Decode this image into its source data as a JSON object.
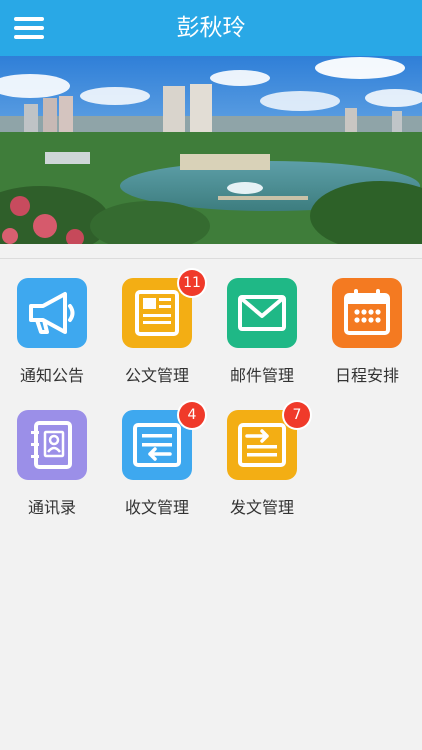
{
  "header": {
    "title": "彭秋玲"
  },
  "apps": [
    {
      "label": "通知公告",
      "icon": "megaphone-icon",
      "color": "#3ea8ef",
      "badge": ""
    },
    {
      "label": "公文管理",
      "icon": "newspaper-icon",
      "color": "#f3ae14",
      "badge": "11"
    },
    {
      "label": "邮件管理",
      "icon": "envelope-icon",
      "color": "#1fb886",
      "badge": ""
    },
    {
      "label": "日程安排",
      "icon": "calendar-icon",
      "color": "#f47a21",
      "badge": ""
    },
    {
      "label": "通讯录",
      "icon": "contacts-book-icon",
      "color": "#9b8fe8",
      "badge": ""
    },
    {
      "label": "收文管理",
      "icon": "inbox-document-icon",
      "color": "#3ea8ef",
      "badge": "4"
    },
    {
      "label": "发文管理",
      "icon": "outbox-document-icon",
      "color": "#f3ae14",
      "badge": "7"
    }
  ]
}
